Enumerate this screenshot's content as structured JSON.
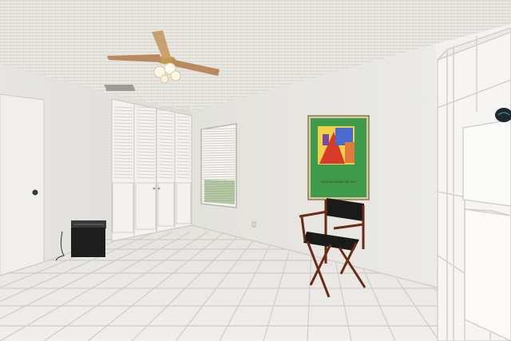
{
  "scene": {
    "description_label": "",
    "poster": {
      "caption": "HIGH MUSEUM OF ART",
      "caption_color": "#4a3a1a",
      "background_color": "#3f9a4c",
      "frame_color": "#d9c9a0"
    },
    "colors": {
      "ceiling": "#e6e4df",
      "wall_left": "#e9e8e4",
      "wall_back": "#e4e3df",
      "wall_right": "#f0efec",
      "floor_tile": "#e8e6e2",
      "grout": "#cfcdc8",
      "chair_frame": "#6b2a16",
      "chair_fabric": "#1a1a1a"
    }
  }
}
